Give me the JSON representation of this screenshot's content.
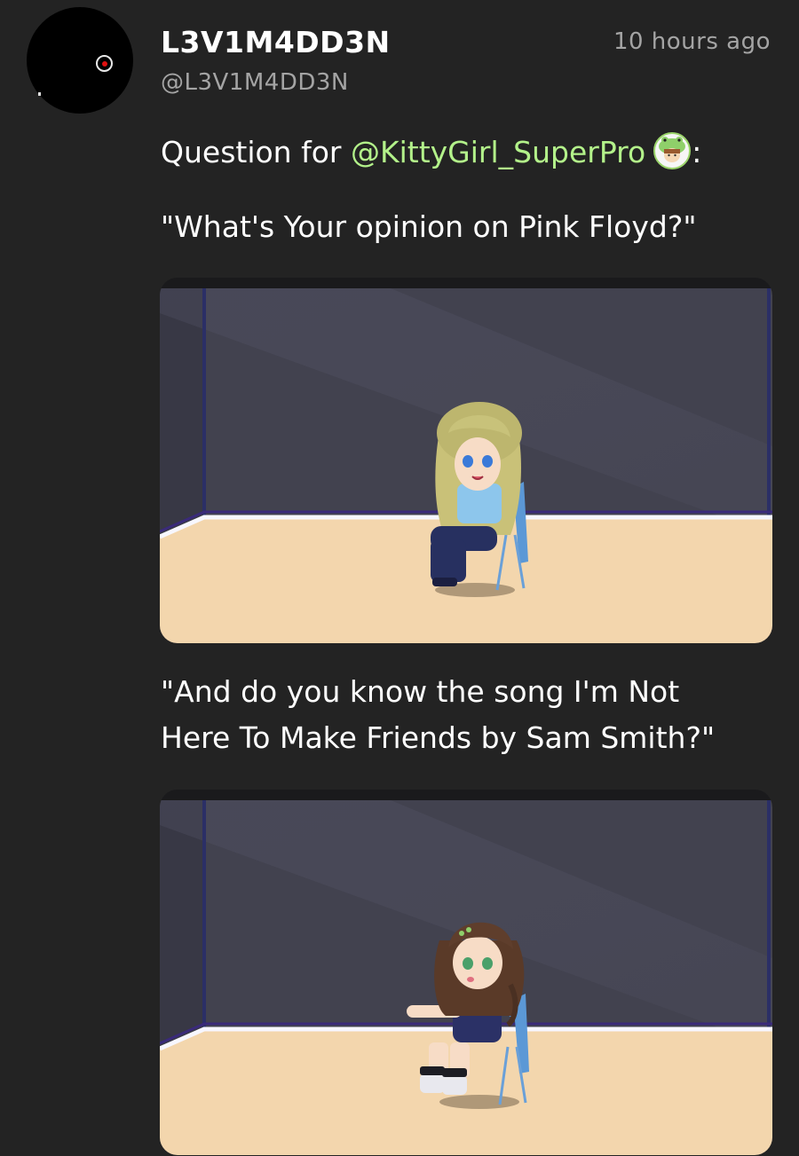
{
  "post": {
    "display_name": "L3V1M4DD3N",
    "handle": "@L3V1M4DD3N",
    "timestamp": "10 hours ago",
    "question_prefix": "Question for ",
    "mention": "@KittyGirl_SuperPro",
    "question_suffix": ":",
    "quote_1": "\"What's Your opinion on Pink Floyd?\"",
    "quote_2_line_1": "\"And do you know the song I'm Not",
    "quote_2_line_2": "Here To Make Friends by Sam Smith?\""
  },
  "icons": {
    "avatar": "record-dot-icon",
    "mention_avatar": "frog-hat-avatar-icon"
  },
  "colors": {
    "background": "#232323",
    "mention": "#b3f28a",
    "muted": "#a4a4a4"
  }
}
